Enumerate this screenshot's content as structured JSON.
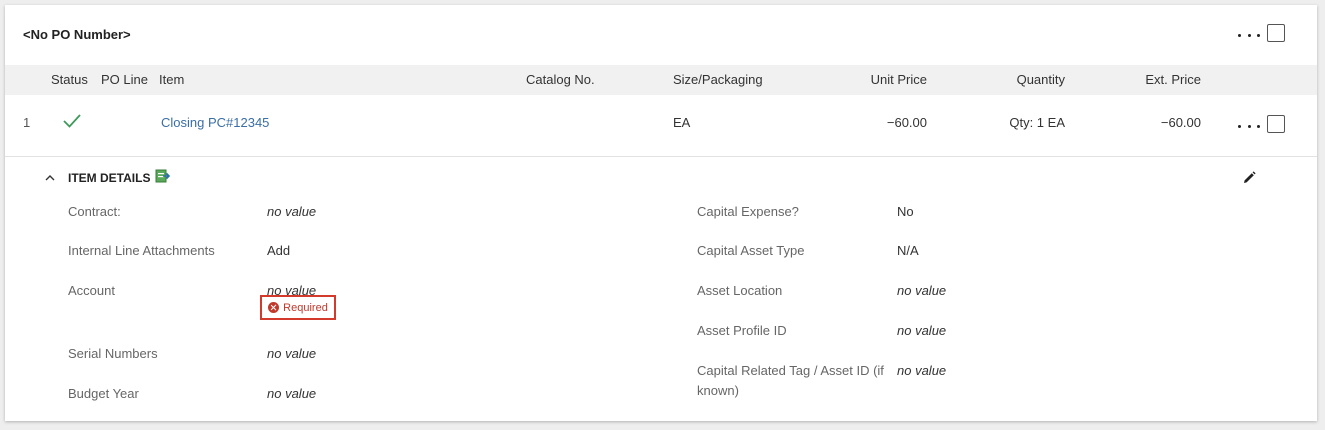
{
  "po": {
    "title": "<No PO Number>"
  },
  "columns": {
    "status": "Status",
    "po_line": "PO Line",
    "item": "Item",
    "catalog_no": "Catalog No.",
    "size_packaging": "Size/Packaging",
    "unit_price": "Unit Price",
    "quantity": "Quantity",
    "ext_price": "Ext. Price"
  },
  "line": {
    "number": "1",
    "status_icon": "checkmark-icon",
    "item": "Closing PC#12345",
    "catalog_no": "",
    "size_packaging": "EA",
    "unit_price": "−60.00",
    "quantity": "Qty: 1 EA",
    "ext_price": "−60.00"
  },
  "details": {
    "title": "ITEM DETAILS",
    "left": {
      "contract_label": "Contract:",
      "contract_value": "no value",
      "attachments_label": "Internal Line Attachments",
      "attachments_value": "Add",
      "account_label": "Account",
      "account_value": "no value",
      "account_required": "Required",
      "serial_label": "Serial Numbers",
      "serial_value": "no value",
      "budget_label": "Budget Year",
      "budget_value": "no value"
    },
    "right": {
      "capex_label": "Capital Expense?",
      "capex_value": "No",
      "asset_type_label": "Capital Asset Type",
      "asset_type_value": "N/A",
      "asset_location_label": "Asset Location",
      "asset_location_value": "no value",
      "asset_profile_label": "Asset Profile ID",
      "asset_profile_value": "no value",
      "capital_tag_label": "Capital Related Tag / Asset ID (if known)",
      "capital_tag_value": "no value"
    }
  },
  "colors": {
    "link": "#3a6ea5",
    "success": "#3d9a5b",
    "error": "#d33a2c",
    "header_bg": "#f1f1f1"
  }
}
